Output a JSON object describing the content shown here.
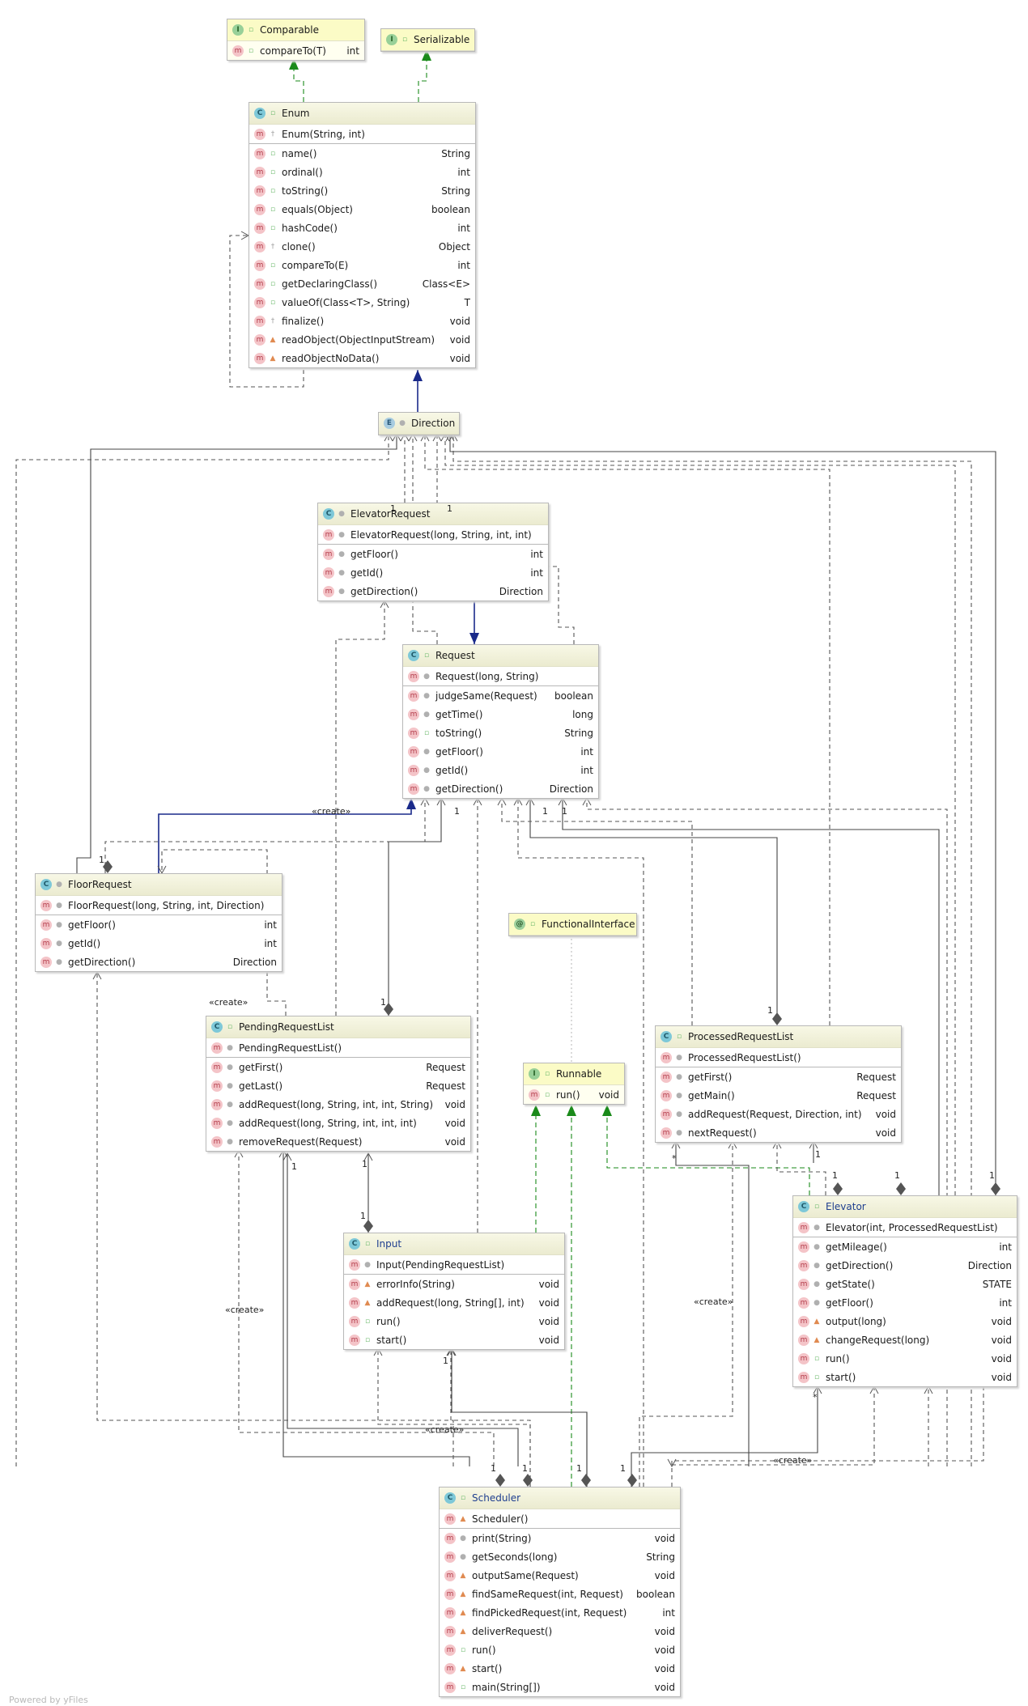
{
  "classes": [
    {
      "id": "comparable",
      "name": "Comparable",
      "kind": "I",
      "vis": "public",
      "ctor": null,
      "methods": [
        {
          "name": "compareTo(T)",
          "ret": "int",
          "vis": "public"
        }
      ]
    },
    {
      "id": "serializable",
      "name": "Serializable",
      "kind": "I",
      "vis": "public",
      "ctor": null,
      "methods": []
    },
    {
      "id": "enum",
      "name": "Enum",
      "kind": "C",
      "vis": "public",
      "ctor": {
        "name": "Enum(String, int)",
        "vis": "protected"
      },
      "methods": [
        {
          "name": "name()",
          "ret": "String",
          "vis": "public"
        },
        {
          "name": "ordinal()",
          "ret": "int",
          "vis": "public"
        },
        {
          "name": "toString()",
          "ret": "String",
          "vis": "public"
        },
        {
          "name": "equals(Object)",
          "ret": "boolean",
          "vis": "public"
        },
        {
          "name": "hashCode()",
          "ret": "int",
          "vis": "public"
        },
        {
          "name": "clone()",
          "ret": "Object",
          "vis": "protected"
        },
        {
          "name": "compareTo(E)",
          "ret": "int",
          "vis": "public"
        },
        {
          "name": "getDeclaringClass()",
          "ret": "Class<E>",
          "vis": "public"
        },
        {
          "name": "valueOf(Class<T>, String)",
          "ret": "T",
          "vis": "public"
        },
        {
          "name": "finalize()",
          "ret": "void",
          "vis": "protected"
        },
        {
          "name": "readObject(ObjectInputStream)",
          "ret": "void",
          "vis": "private"
        },
        {
          "name": "readObjectNoData()",
          "ret": "void",
          "vis": "private"
        }
      ]
    },
    {
      "id": "direction",
      "name": "Direction",
      "kind": "E",
      "vis": "package",
      "ctor": null,
      "methods": []
    },
    {
      "id": "elevatorrequest",
      "name": "ElevatorRequest",
      "kind": "C",
      "vis": "package",
      "ctor": {
        "name": "ElevatorRequest(long, String, int, int)",
        "vis": "package"
      },
      "methods": [
        {
          "name": "getFloor()",
          "ret": "int",
          "vis": "package"
        },
        {
          "name": "getId()",
          "ret": "int",
          "vis": "package"
        },
        {
          "name": "getDirection()",
          "ret": "Direction",
          "vis": "package"
        }
      ]
    },
    {
      "id": "request",
      "name": "Request",
      "kind": "C",
      "vis": "public",
      "ctor": {
        "name": "Request(long, String)",
        "vis": "package"
      },
      "methods": [
        {
          "name": "judgeSame(Request)",
          "ret": "boolean",
          "vis": "package"
        },
        {
          "name": "getTime()",
          "ret": "long",
          "vis": "package"
        },
        {
          "name": "toString()",
          "ret": "String",
          "vis": "public"
        },
        {
          "name": "getFloor()",
          "ret": "int",
          "vis": "package"
        },
        {
          "name": "getId()",
          "ret": "int",
          "vis": "package"
        },
        {
          "name": "getDirection()",
          "ret": "Direction",
          "vis": "package"
        }
      ]
    },
    {
      "id": "floorrequest",
      "name": "FloorRequest",
      "kind": "C",
      "vis": "package",
      "ctor": {
        "name": "FloorRequest(long, String, int, Direction)",
        "vis": "package"
      },
      "methods": [
        {
          "name": "getFloor()",
          "ret": "int",
          "vis": "package"
        },
        {
          "name": "getId()",
          "ret": "int",
          "vis": "package"
        },
        {
          "name": "getDirection()",
          "ret": "Direction",
          "vis": "package"
        }
      ]
    },
    {
      "id": "functionalinterface",
      "name": "FunctionalInterface",
      "kind": "@",
      "vis": "public",
      "ctor": null,
      "methods": []
    },
    {
      "id": "pendingrequestlist",
      "name": "PendingRequestList",
      "kind": "C",
      "vis": "public",
      "ctor": {
        "name": "PendingRequestList()",
        "vis": "package"
      },
      "methods": [
        {
          "name": "getFirst()",
          "ret": "Request",
          "vis": "package"
        },
        {
          "name": "getLast()",
          "ret": "Request",
          "vis": "package"
        },
        {
          "name": "addRequest(long, String, int, int, String)",
          "ret": "void",
          "vis": "package"
        },
        {
          "name": "addRequest(long, String, int, int, int)",
          "ret": "void",
          "vis": "package"
        },
        {
          "name": "removeRequest(Request)",
          "ret": "void",
          "vis": "package"
        }
      ]
    },
    {
      "id": "runnable",
      "name": "Runnable",
      "kind": "I",
      "vis": "public",
      "ctor": null,
      "methods": [
        {
          "name": "run()",
          "ret": "void",
          "vis": "public"
        }
      ]
    },
    {
      "id": "processedrequestlist",
      "name": "ProcessedRequestList",
      "kind": "C",
      "vis": "public",
      "ctor": {
        "name": "ProcessedRequestList()",
        "vis": "package"
      },
      "methods": [
        {
          "name": "getFirst()",
          "ret": "Request",
          "vis": "package"
        },
        {
          "name": "getMain()",
          "ret": "Request",
          "vis": "package"
        },
        {
          "name": "addRequest(Request, Direction, int)",
          "ret": "void",
          "vis": "package"
        },
        {
          "name": "nextRequest()",
          "ret": "void",
          "vis": "package"
        }
      ]
    },
    {
      "id": "input",
      "name": "Input",
      "kind": "C",
      "vis": "public",
      "ctor": {
        "name": "Input(PendingRequestList)",
        "vis": "package"
      },
      "methods": [
        {
          "name": "errorInfo(String)",
          "ret": "void",
          "vis": "private"
        },
        {
          "name": "addRequest(long, String[], int)",
          "ret": "void",
          "vis": "private"
        },
        {
          "name": "run()",
          "ret": "void",
          "vis": "public"
        },
        {
          "name": "start()",
          "ret": "void",
          "vis": "public"
        }
      ]
    },
    {
      "id": "elevator",
      "name": "Elevator",
      "kind": "C",
      "vis": "public",
      "ctor": {
        "name": "Elevator(int, ProcessedRequestList)",
        "vis": "package"
      },
      "methods": [
        {
          "name": "getMileage()",
          "ret": "int",
          "vis": "package"
        },
        {
          "name": "getDirection()",
          "ret": "Direction",
          "vis": "package"
        },
        {
          "name": "getState()",
          "ret": "STATE",
          "vis": "package"
        },
        {
          "name": "getFloor()",
          "ret": "int",
          "vis": "package"
        },
        {
          "name": "output(long)",
          "ret": "void",
          "vis": "private"
        },
        {
          "name": "changeRequest(long)",
          "ret": "void",
          "vis": "private"
        },
        {
          "name": "run()",
          "ret": "void",
          "vis": "public"
        },
        {
          "name": "start()",
          "ret": "void",
          "vis": "public"
        }
      ]
    },
    {
      "id": "scheduler",
      "name": "Scheduler",
      "kind": "C",
      "vis": "public",
      "ctor": {
        "name": "Scheduler()",
        "vis": "private"
      },
      "methods": [
        {
          "name": "print(String)",
          "ret": "void",
          "vis": "package"
        },
        {
          "name": "getSeconds(long)",
          "ret": "String",
          "vis": "package"
        },
        {
          "name": "outputSame(Request)",
          "ret": "void",
          "vis": "private"
        },
        {
          "name": "findSameRequest(int, Request)",
          "ret": "boolean",
          "vis": "private"
        },
        {
          "name": "findPickedRequest(int, Request)",
          "ret": "int",
          "vis": "private"
        },
        {
          "name": "deliverRequest()",
          "ret": "void",
          "vis": "private"
        },
        {
          "name": "run()",
          "ret": "void",
          "vis": "public"
        },
        {
          "name": "start()",
          "ret": "void",
          "vis": "private"
        },
        {
          "name": "main(String[])",
          "ret": "void",
          "vis": "public"
        }
      ]
    }
  ],
  "labels": {
    "create": "«create»",
    "one": "1",
    "many": "*"
  },
  "footer": "Powered by yFiles",
  "colors": {
    "realization": "#1a8a1a",
    "inheritance": "#1a2a8a",
    "dependency": "#555555"
  }
}
